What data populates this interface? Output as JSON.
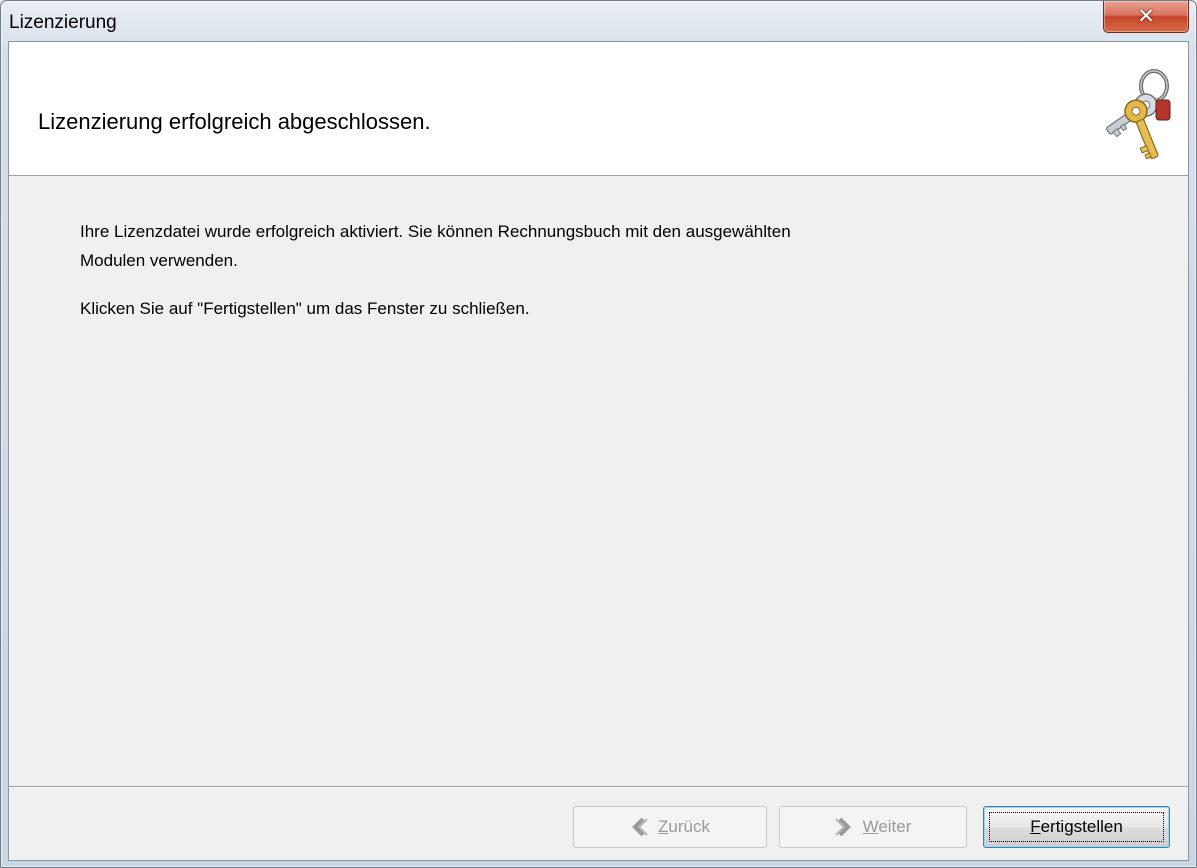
{
  "window": {
    "title": "Lizenzierung"
  },
  "header": {
    "title": "Lizenzierung erfolgreich abgeschlossen.",
    "icon": "keys-icon"
  },
  "body": {
    "paragraph1_line1": "Ihre Lizenzdatei wurde erfolgreich aktiviert. Sie können Rechnungsbuch mit den ausgewählten",
    "paragraph1_line2": "Modulen verwenden.",
    "paragraph2": "Klicken Sie auf \"Fertigstellen\" um das Fenster zu schließen."
  },
  "buttons": {
    "back_access_key": "Z",
    "back_rest": "urück",
    "next_access_key": "W",
    "next_rest": "eiter",
    "finish_access_key": "F",
    "finish_rest": "ertigstellen",
    "back_enabled": false,
    "next_enabled": false,
    "finish_enabled": true
  },
  "colors": {
    "close_button": "#c7442a",
    "header_bg": "#ffffff",
    "client_bg": "#f0f0f0"
  }
}
